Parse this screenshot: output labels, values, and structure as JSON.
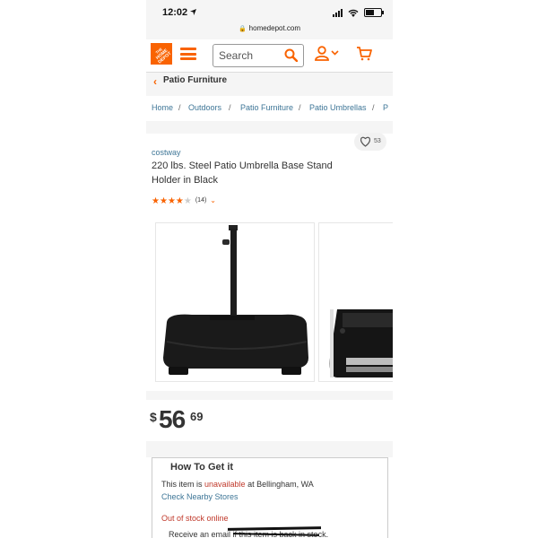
{
  "status_bar": {
    "time": "12:02",
    "location_arrow": "location-arrow-icon",
    "url": "homedepot.com"
  },
  "header": {
    "logo_text": "THE HOME DEPOT",
    "search_placeholder": "Search",
    "brand_color": "#f96302"
  },
  "back_link": {
    "label": "Patio Furniture"
  },
  "breadcrumbs": [
    "Home",
    "Outdoors",
    "Patio Furniture",
    "Patio Umbrellas",
    "P"
  ],
  "product": {
    "favorites_count": "53",
    "brand": "costway",
    "title": "220 lbs. Steel Patio Umbrella Base Stand Holder in Black",
    "rating": 4,
    "rating_max": 5,
    "review_count": "(14)",
    "price": {
      "currency": "$",
      "dollars": "56",
      "cents": "69"
    }
  },
  "how_to_get_it": {
    "title": "How To Get it",
    "availability_prefix": "This item is ",
    "availability_status": "unavailable",
    "availability_suffix": " at Bellingham, WA",
    "check_nearby": "Check Nearby Stores",
    "out_of_stock": "Out of stock online",
    "email_notice": "Receive an email if this item is back in stock."
  }
}
